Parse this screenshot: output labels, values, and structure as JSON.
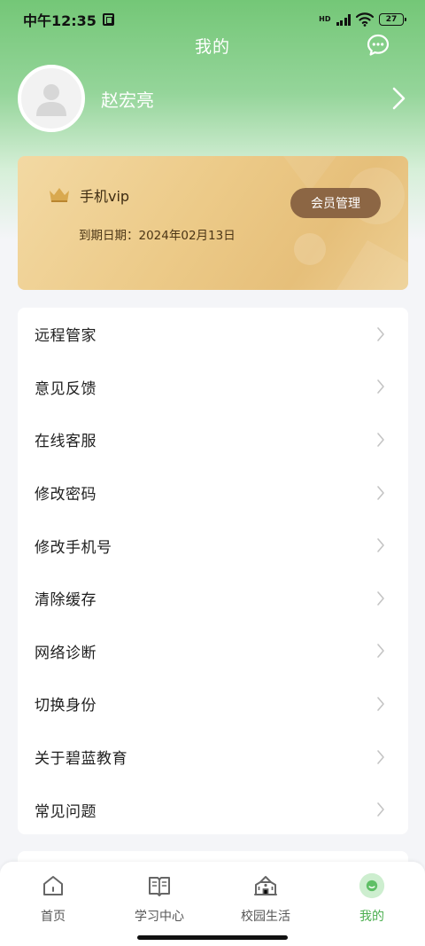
{
  "status_bar": {
    "time": "中午12:35",
    "network": "HD",
    "battery": "27"
  },
  "header": {
    "title": "我的"
  },
  "profile": {
    "name": "赵宏亮"
  },
  "vip": {
    "title": "手机vip",
    "expire_label": "到期日期：",
    "expire_date": "2024年02月13日",
    "manage_button": "会员管理"
  },
  "menu": {
    "items": [
      {
        "label": "远程管家"
      },
      {
        "label": "意见反馈"
      },
      {
        "label": "在线客服"
      },
      {
        "label": "修改密码"
      },
      {
        "label": "修改手机号"
      },
      {
        "label": "清除缓存"
      },
      {
        "label": "网络诊断"
      },
      {
        "label": "切换身份"
      },
      {
        "label": "关于碧蓝教育"
      },
      {
        "label": "常见问题"
      }
    ]
  },
  "tabs": [
    {
      "label": "首页",
      "icon": "home-icon"
    },
    {
      "label": "学习中心",
      "icon": "book-icon"
    },
    {
      "label": "校园生活",
      "icon": "school-icon"
    },
    {
      "label": "我的",
      "icon": "smile-icon"
    }
  ],
  "colors": {
    "accent": "#4caf50",
    "header_green": "#74c777",
    "vip_button": "#8c6644"
  }
}
